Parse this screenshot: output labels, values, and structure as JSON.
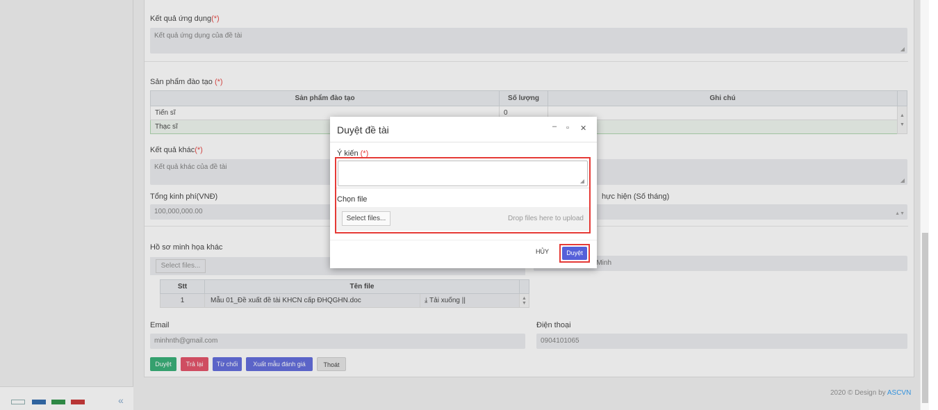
{
  "form": {
    "ket_qua_ung_dung": {
      "label": "Kết quả ứng dụng",
      "req": "(*)",
      "value": "Kết quả ứng dụng của đề tài"
    },
    "san_pham_dao_tao": {
      "label": "Sản phẩm đào tạo ",
      "req": "(*)",
      "columns": [
        "Sản phẩm đào tạo",
        "Số lượng",
        "Ghi chú"
      ],
      "rows": [
        {
          "name": "Tiến sĩ",
          "qty": "0",
          "note": ""
        },
        {
          "name": "Thạc sĩ",
          "qty": "",
          "note": ""
        }
      ]
    },
    "ket_qua_khac": {
      "label": "Kết quả khác",
      "req": "(*)",
      "value": "Kết quả khác của đề tài"
    },
    "tong_kinh_phi": {
      "label": "Tổng kinh phí(VNĐ)",
      "value": "100,000,000.00"
    },
    "thoi_gian": {
      "label_partial": "hực hiện (Số tháng)"
    },
    "ho_so": {
      "label": "Hồ sơ minh họa khác",
      "select_files": "Select files...",
      "drop_partial": "Drop files here to upload",
      "columns": [
        "Stt",
        "Tên file"
      ],
      "rows": [
        {
          "stt": "1",
          "name": "Mẫu 01_Đề xuất đề tài KHCN cấp ĐHQGHN.doc",
          "action": "Tải xuống ||"
        }
      ]
    },
    "chu_nhiem_partial": "g Minh",
    "email": {
      "label": "Email",
      "value": "minhnth@gmail.com"
    },
    "dien_thoai": {
      "label": "Điện thoại",
      "value": "0904101065"
    }
  },
  "actions": {
    "duyet": "Duyệt",
    "tra_lai": "Trả lại",
    "tu_choi": "Từ chối",
    "xuat_mau": "Xuất mẫu đánh giá",
    "thoat": "Thoát"
  },
  "dialog": {
    "title": "Duyệt đề tài",
    "y_kien_label": "Ý kiến",
    "y_kien_req": "(*)",
    "y_kien_value": "",
    "chon_file_label": "Chọn file",
    "select_files": "Select files...",
    "drop_text": "Drop files here to upload",
    "cancel": "HỦY",
    "approve": "Duyệt"
  },
  "footer": {
    "text": "2020 © Design by ",
    "brand": "ASCVN"
  },
  "theme_swatches": [
    "#ffffff",
    "#1f5fa6",
    "#1e8c3a",
    "#c62828"
  ],
  "colors": {
    "accent": "#5560d9",
    "required": "#e53935",
    "success": "#26a96c",
    "danger": "#e2445c"
  }
}
